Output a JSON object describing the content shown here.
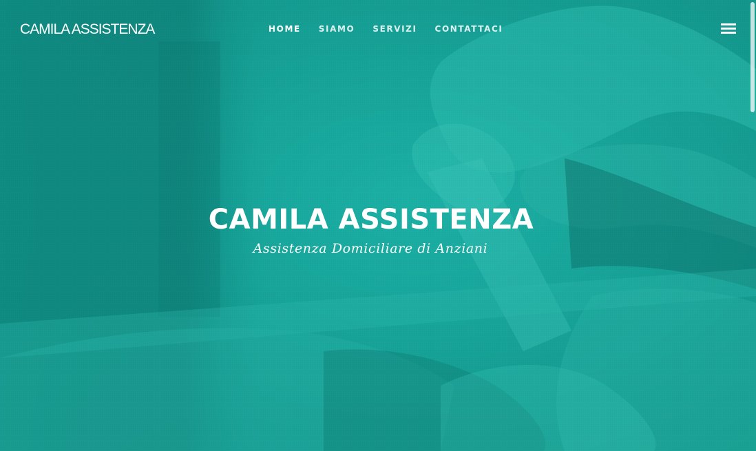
{
  "site": {
    "brand": "CAMILA ASSISTENZA"
  },
  "nav": {
    "items": [
      {
        "label": "HOME",
        "active": true
      },
      {
        "label": "SIAMO",
        "active": false
      },
      {
        "label": "SERVIZI",
        "active": false
      },
      {
        "label": "CONTATTACI",
        "active": false
      }
    ],
    "menu_icon": "hamburger-menu-icon"
  },
  "hero": {
    "title": "CAMILA ASSISTENZA",
    "subtitle": "Assistenza Domiciliare di Anziani",
    "overlay_color": "#17a79c",
    "image_subject": "hands-care-photo"
  }
}
